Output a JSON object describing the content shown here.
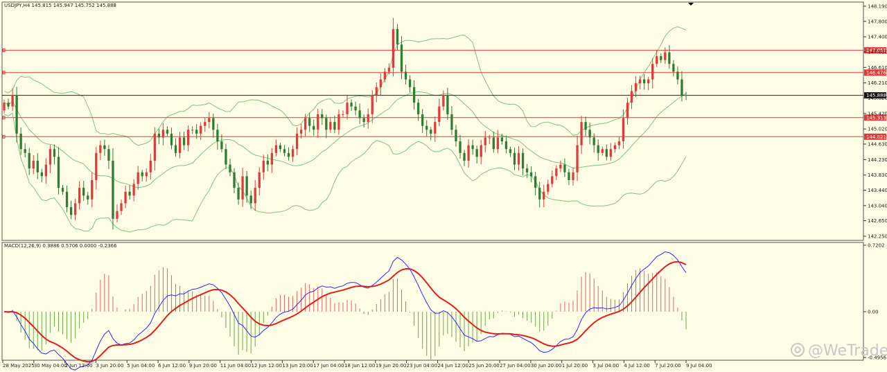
{
  "header": {
    "main_info": "USDJPY,H4  145.815 145.947 145.752 145.888",
    "macd_info": "MACD(12,26,9) 0.3886 0.5706 0.0000 -0.2366"
  },
  "watermark": {
    "text": "@WeTrade",
    "icon": "wetrade-logo-icon"
  },
  "colors": {
    "background": "#fffde6",
    "bull": "#e03b3b",
    "bear": "#2e7d32",
    "bollinger": "#7cc57f",
    "hline": "#e53935",
    "price_line": "#222222",
    "macd_line": "#2a2aff",
    "signal_line": "#e01e1e",
    "hist_pos": "#e06666",
    "hist_neg": "#6aa84f"
  },
  "chart_data": [
    {
      "type": "candlestick",
      "symbol": "USDJPY",
      "timeframe": "H4",
      "ohlc_header": {
        "open": 145.815,
        "high": 145.947,
        "low": 145.752,
        "close": 145.888
      },
      "ylim": [
        142.25,
        148.19
      ],
      "y_ticks": [
        "148.190",
        "147.800",
        "147.400",
        "147.010",
        "146.610",
        "146.210",
        "145.820",
        "145.420",
        "145.020",
        "144.630",
        "144.230",
        "143.830",
        "143.440",
        "143.040",
        "142.650",
        "142.250"
      ],
      "x_ticks": [
        "28 May 2025",
        "30 May 04:00",
        "2 Jun 12:00",
        "3 Jun 20:00",
        "5 Jun 04:00",
        "6 Jun 12:00",
        "9 Jun 20:00",
        "11 Jun 04:00",
        "12 Jun 12:00",
        "13 Jun 20:00",
        "17 Jun 04:00",
        "18 Jun 12:00",
        "19 Jun 20:00",
        "23 Jun 04:00",
        "24 Jun 12:00",
        "25 Jun 20:00",
        "27 Jun 04:00",
        "30 Jun 20:00",
        "1 Jul 20:00",
        "3 Jul 04:00",
        "4 Jul 12:00",
        "7 Jul 20:00",
        "9 Jul 04:00"
      ],
      "horizontal_levels": [
        {
          "value": 147.051,
          "label": "147.051"
        },
        {
          "value": 146.476,
          "label": "146.476"
        },
        {
          "value": 145.313,
          "label": "145.313"
        },
        {
          "value": 144.821,
          "label": "144.821"
        }
      ],
      "current_price": {
        "value": 145.888,
        "label": "145.888"
      },
      "indicator": "Bollinger Bands",
      "close": [
        145.7,
        145.6,
        145.9,
        144.9,
        144.5,
        144.4,
        144.0,
        144.2,
        143.9,
        143.8,
        144.1,
        144.5,
        144.3,
        143.5,
        143.4,
        143.0,
        142.8,
        143.1,
        143.5,
        143.3,
        143.2,
        143.7,
        144.4,
        144.6,
        144.5,
        144.2,
        142.7,
        142.9,
        143.1,
        143.4,
        143.3,
        143.6,
        143.9,
        143.8,
        143.9,
        144.2,
        144.9,
        144.8,
        145.0,
        144.9,
        144.6,
        144.4,
        144.8,
        144.6,
        145.0,
        145.0,
        144.9,
        145.1,
        145.2,
        145.3,
        145.0,
        144.7,
        144.5,
        144.1,
        143.9,
        143.5,
        143.2,
        143.8,
        143.3,
        143.1,
        143.5,
        143.9,
        144.2,
        144.1,
        144.4,
        144.6,
        144.5,
        144.4,
        144.3,
        144.5,
        144.9,
        145.0,
        145.3,
        145.1,
        145.0,
        145.4,
        145.3,
        145.0,
        145.2,
        145.0,
        145.4,
        145.4,
        145.7,
        145.6,
        145.5,
        145.3,
        145.2,
        145.4,
        145.9,
        146.1,
        146.3,
        146.5,
        146.6,
        147.6,
        147.2,
        146.5,
        146.3,
        146.1,
        145.7,
        145.4,
        145.1,
        145.0,
        144.9,
        145.2,
        145.6,
        145.9,
        145.4,
        145.0,
        144.7,
        144.4,
        144.2,
        144.6,
        144.5,
        144.3,
        144.6,
        144.8,
        144.8,
        144.5,
        144.8,
        144.7,
        144.5,
        144.4,
        144.1,
        144.4,
        144.0,
        143.9,
        143.8,
        143.5,
        143.2,
        143.4,
        143.6,
        143.8,
        144.0,
        144.1,
        143.9,
        143.7,
        143.9,
        144.6,
        145.2,
        145.0,
        144.8,
        144.6,
        144.4,
        144.5,
        144.3,
        144.5,
        144.6,
        144.7,
        145.3,
        145.7,
        146.0,
        146.2,
        146.3,
        146.2,
        146.3,
        146.7,
        146.9,
        146.8,
        147.0,
        146.7,
        146.5,
        146.3,
        145.9,
        145.89
      ]
    },
    {
      "type": "macd",
      "name": "MACD(12,26,9)",
      "values": {
        "macd": 0.3886,
        "signal": 0.5706,
        "value3": 0.0,
        "value4": -0.2366
      },
      "ylim": [
        -0.4956,
        0.7202
      ],
      "y_ticks": [
        "0.7202",
        "0.00",
        "-0.4956"
      ]
    }
  ]
}
